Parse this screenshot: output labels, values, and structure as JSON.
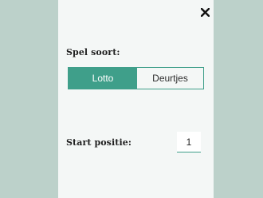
{
  "dialog": {
    "close_icon": "close-icon",
    "game_type_label": "Spel soort:",
    "game_types": [
      {
        "label": "Lotto",
        "selected": true
      },
      {
        "label": "Deurtjes",
        "selected": false
      }
    ],
    "start_position_label": "Start positie:",
    "start_position_value": "1"
  },
  "colors": {
    "background": "#bcd1ca",
    "panel": "#f4f7f6",
    "accent": "#3f9f8a"
  }
}
